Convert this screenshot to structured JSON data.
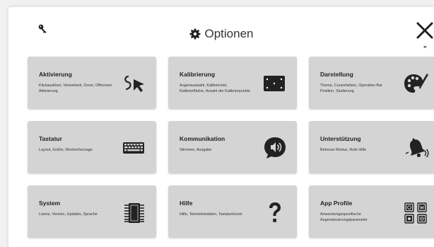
{
  "header": {
    "title": "Optionen",
    "close_sub": "\""
  },
  "tiles": [
    {
      "title": "Aktivierung",
      "desc": "Klickauslöser, Verweilzeit, Zoom, Offscreen Aktivierung",
      "icon": "swipe-click-icon"
    },
    {
      "title": "Kalibrierung",
      "desc": "Augenauswahl, Kalibrierziel, Kalibrierfläche, Anzahl der Kalibrierpunkte",
      "icon": "calibration-screen-icon"
    },
    {
      "title": "Darstellung",
      "desc": "Theme, Cursorfarben, Operation Bar Position, Skalierung",
      "icon": "palette-icon"
    },
    {
      "title": "Tastatur",
      "desc": "Layout, Größe, Wortvorhersage",
      "icon": "keyboard-icon"
    },
    {
      "title": "Kommunikation",
      "desc": "Stimmen, Ausgabe",
      "icon": "speech-bubble-icon"
    },
    {
      "title": "Unterstützung",
      "desc": "Betreuer Modus, Rufe Hilfe",
      "icon": "bell-icon"
    },
    {
      "title": "System",
      "desc": "Lizenz, Version, Updates, Sprache",
      "icon": "chip-icon"
    },
    {
      "title": "Hilfe",
      "desc": "Hilfe, Telemetriedaten, Tastaturkürzel",
      "icon": "question-icon"
    },
    {
      "title": "App Profile",
      "desc": "Anwendungsspezifische Augensteuerungsparameter",
      "icon": "app-grid-icon"
    }
  ]
}
